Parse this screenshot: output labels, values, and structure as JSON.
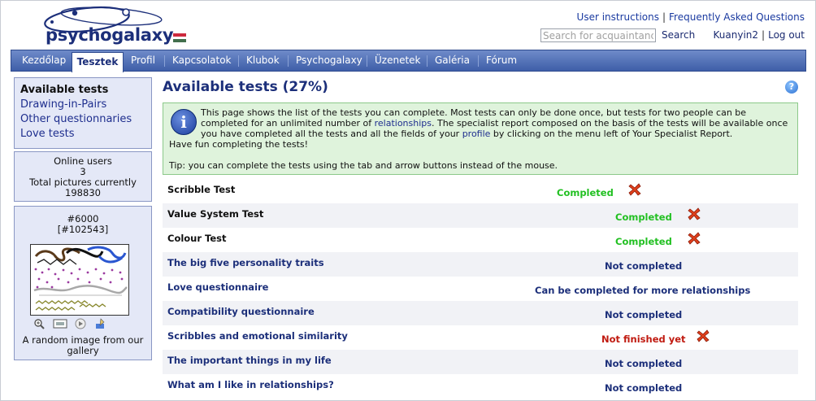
{
  "brand": {
    "logo_text": "psychogalaxy",
    "flag_colors": [
      "#cd2a3e",
      "#ffffff",
      "#436f4d"
    ]
  },
  "header": {
    "links": [
      "User instructions",
      "Frequently Asked Questions"
    ],
    "search_placeholder": "Search for acquaintanc",
    "search_label": "Search",
    "username": "Kuanyin2",
    "logout_label": "Log out"
  },
  "nav": {
    "items": [
      "Kezdőlap",
      "Tesztek",
      "Profil",
      "Kapcsolatok",
      "Klubok",
      "Psychogalaxy",
      "Üzenetek",
      "Galéria",
      "Fórum"
    ],
    "active": "Tesztek"
  },
  "sidebar": {
    "title": "Available tests",
    "links": [
      "Drawing-in-Pairs",
      "Other questionnaries",
      "Love tests"
    ],
    "online_label": "Online users",
    "online_count": "3",
    "pictures_label": "Total pictures currently",
    "pictures_count": "198830",
    "gallery_id": "#6000",
    "gallery_sub": "[#102543]",
    "gallery_caption": "A random image from our gallery",
    "tool_icons": [
      "zoom-icon",
      "slideshow-icon",
      "next-icon",
      "draw-icon"
    ]
  },
  "main": {
    "title": "Available tests (27%)",
    "info": {
      "line1_pre": "This page shows the list of the tests you can complete. Most tests can only be done once, but tests for two people can be completed for an unlimited number of ",
      "link1": "relationships",
      "line1_mid": ". The specialist report composed on the basis of the tests will be available once you have completed all the tests and all the fields of your ",
      "link2": "profile",
      "line1_post": " by clicking on the menu left of Your Specialist Report.",
      "line2": "Have fun completing the tests!",
      "tip": "Tip: you can complete the tests using the tab and arrow buttons instead of the mouse."
    },
    "tests": [
      {
        "name": "Scribble Test",
        "status": "Completed",
        "kind": "green",
        "x_icon": true
      },
      {
        "name": "Value System Test",
        "status": "Completed",
        "kind": "green",
        "x_icon": true
      },
      {
        "name": "Colour Test",
        "status": "Completed",
        "kind": "green",
        "x_icon": true
      },
      {
        "name": "The big five personality traits",
        "status": "Not completed",
        "kind": "blue",
        "x_icon": false
      },
      {
        "name": "Love questionnaire",
        "status": "Can be completed for more relationships",
        "kind": "blue",
        "x_icon": false
      },
      {
        "name": "Compatibility questionnaire",
        "status": "Not completed",
        "kind": "blue",
        "x_icon": false
      },
      {
        "name": "Scribbles and emotional similarity",
        "status": "Not finished yet",
        "kind": "red",
        "x_icon": true
      },
      {
        "name": "The important things in my life",
        "status": "Not completed",
        "kind": "blue",
        "x_icon": false
      },
      {
        "name": "What am I like in relationships?",
        "status": "Not completed",
        "kind": "blue",
        "x_icon": false
      }
    ]
  }
}
